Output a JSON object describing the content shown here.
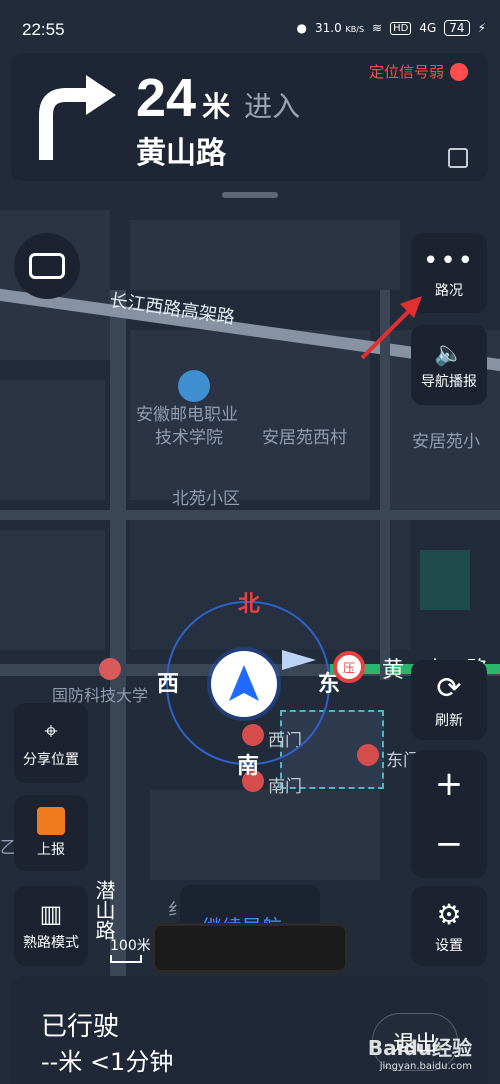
{
  "status_bar": {
    "time": "22:55",
    "net_speed": "31.0",
    "net_speed_unit": "KB/S",
    "hd": "HD",
    "signal": "4G",
    "battery": "74"
  },
  "nav": {
    "distance": "24",
    "unit": "米",
    "action": "进入",
    "road": "黄山路",
    "signal_warning": "定位信号弱"
  },
  "right_buttons": {
    "traffic": "路况",
    "voice": "导航播报",
    "refresh": "刷新",
    "settings": "设置"
  },
  "left_buttons": {
    "share": "分享位置",
    "report": "上报",
    "familiar": "熟路模式"
  },
  "compass": {
    "north": "北",
    "south": "南",
    "east": "东",
    "west": "西"
  },
  "map_labels": {
    "road1": "长江西路高架路",
    "poi1_line1": "安徽邮电职业",
    "poi1_line2": "技术学院",
    "poi2": "安居苑西村",
    "poi3": "安居苑小",
    "poi4": "北苑小区",
    "poi5": "国防科技大学",
    "road2": "黄山路",
    "gate_west": "西门",
    "gate_south": "南门",
    "gate_east": "东门",
    "road3": "潜山路",
    "letter_yi": "乙",
    "fragment": "纟"
  },
  "scale": "100米",
  "continue_nav": "继续导航",
  "trip": {
    "traveled": "已行驶",
    "summary": "--米 <1分钟",
    "exit": "退出"
  },
  "watermark": {
    "brand": "Baidu经验",
    "url": "jingyan.baidu.com"
  },
  "colors": {
    "background": "#222b3a",
    "card": "#1e2534",
    "accent_blue": "#1f6bff",
    "warning_red": "#ff4d4d",
    "route_green": "#29b56b"
  }
}
